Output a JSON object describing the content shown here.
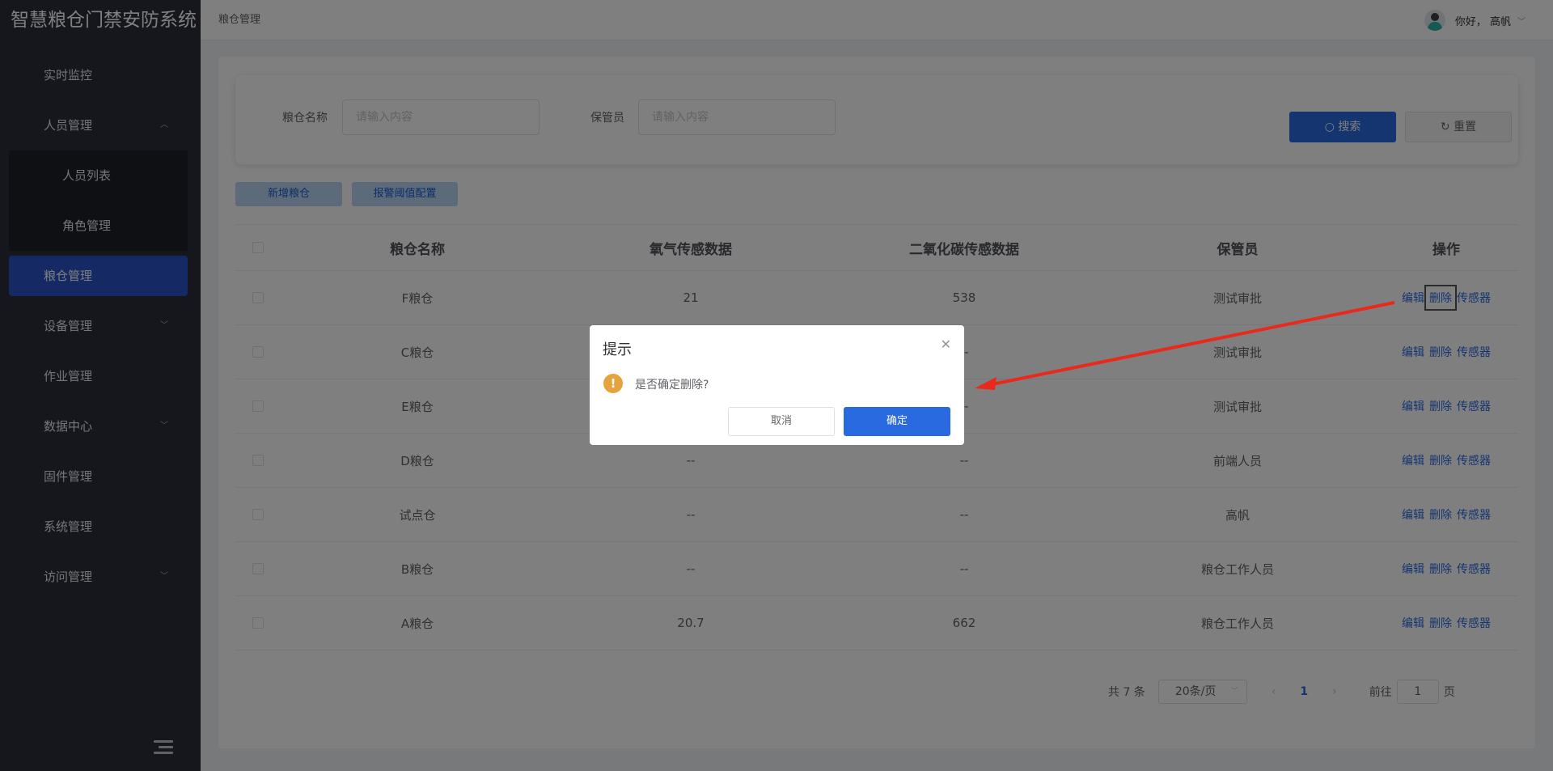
{
  "app": {
    "title": "智慧粮仓门禁安防系统"
  },
  "sidebar": {
    "items": [
      {
        "label": "实时监控"
      },
      {
        "label": "人员管理",
        "arrow": "︿"
      },
      {
        "label": "人员列表"
      },
      {
        "label": "角色管理"
      },
      {
        "label": "粮仓管理"
      },
      {
        "label": "设备管理",
        "arrow": "﹀"
      },
      {
        "label": "作业管理"
      },
      {
        "label": "数据中心",
        "arrow": "﹀"
      },
      {
        "label": "固件管理"
      },
      {
        "label": "系统管理"
      },
      {
        "label": "访问管理",
        "arrow": "﹀"
      }
    ]
  },
  "header": {
    "breadcrumb": "粮仓管理",
    "greeting": "你好，  高帆",
    "caret": "﹀"
  },
  "search": {
    "name_label": "粮仓名称",
    "name_placeholder": "请输入内容",
    "keeper_label": "保管员",
    "keeper_placeholder": "请输入内容",
    "search_btn": "搜索",
    "reset_btn": "重置"
  },
  "actions": {
    "add": "新增粮仓",
    "alarm": "报警阈值配置"
  },
  "table": {
    "columns": [
      "粮仓名称",
      "氧气传感数据",
      "二氧化碳传感数据",
      "保管员",
      "操作"
    ],
    "ops": {
      "edit": "编辑",
      "delete": "删除",
      "sensor": "传感器"
    },
    "rows": [
      {
        "name": "F粮仓",
        "o2": "21",
        "co2": "538",
        "keeper": "测试审批"
      },
      {
        "name": "C粮仓",
        "o2": "--",
        "co2": "--",
        "keeper": "测试审批"
      },
      {
        "name": "E粮仓",
        "o2": "--",
        "co2": "--",
        "keeper": "测试审批"
      },
      {
        "name": "D粮仓",
        "o2": "--",
        "co2": "--",
        "keeper": "前端人员"
      },
      {
        "name": "试点仓",
        "o2": "--",
        "co2": "--",
        "keeper": "高帆"
      },
      {
        "name": "B粮仓",
        "o2": "--",
        "co2": "--",
        "keeper": "粮仓工作人员"
      },
      {
        "name": "A粮仓",
        "o2": "20.7",
        "co2": "662",
        "keeper": "粮仓工作人员"
      }
    ]
  },
  "pagination": {
    "total": "共 7 条",
    "page_size": "20条/页",
    "prev": "‹",
    "current": "1",
    "next": "›",
    "goto_prefix": "前往",
    "goto_value": "1",
    "goto_suffix": "页"
  },
  "dialog": {
    "title": "提示",
    "message": "是否确定删除?",
    "cancel": "取消",
    "confirm": "确定",
    "close": "✕",
    "icon": "!"
  },
  "colors": {
    "primary": "#2a6ae0",
    "sidebar": "#2b2f3a",
    "active": "#2a55c8",
    "warning": "#e6a23c",
    "annotation": "#e8291c"
  }
}
